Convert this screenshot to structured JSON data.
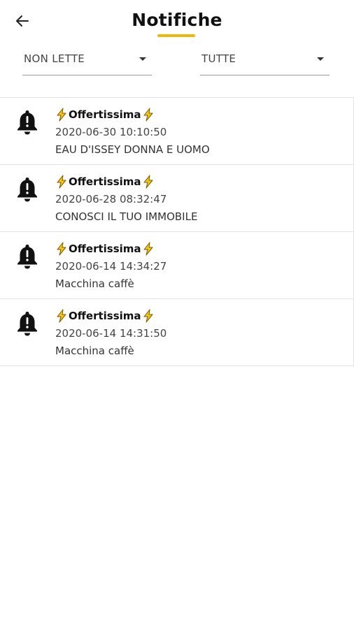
{
  "header": {
    "title": "Notifiche"
  },
  "filters": {
    "status": {
      "value": "NON LETTE"
    },
    "type": {
      "value": "TUTTE"
    }
  },
  "colors": {
    "accent": "#f2b705",
    "bolt_fill": "#f5c518"
  },
  "notifications": [
    {
      "title": "Offertissima",
      "date": "2020-06-30 10:10:50",
      "text": "EAU D'ISSEY DONNA E UOMO"
    },
    {
      "title": "Offertissima",
      "date": "2020-06-28 08:32:47",
      "text": "CONOSCI IL TUO IMMOBILE"
    },
    {
      "title": "Offertissima",
      "date": "2020-06-14 14:34:27",
      "text": "Macchina caffè"
    },
    {
      "title": "Offertissima",
      "date": "2020-06-14 14:31:50",
      "text": "Macchina caffè"
    }
  ]
}
